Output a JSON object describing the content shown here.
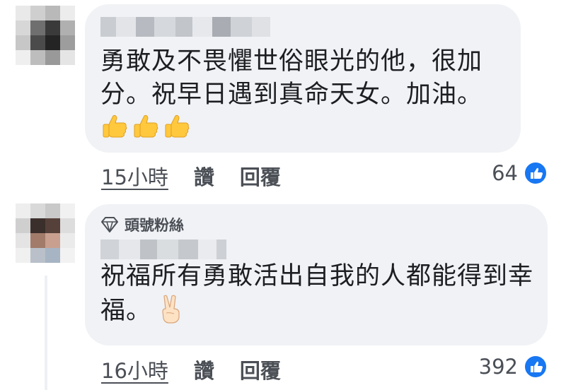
{
  "comments": [
    {
      "text": "勇敢及不畏懼世俗眼光的他，很加分。祝早日遇到真命天女。加油。",
      "emoji": [
        "thumbs-up",
        "thumbs-up",
        "thumbs-up"
      ],
      "timestamp": "15小時",
      "like_label": "讚",
      "reply_label": "回覆",
      "reaction_count": "64"
    },
    {
      "badge": "頭號粉絲",
      "text": "祝福所有勇敢活出自我的人都能得到幸福。",
      "emoji": [
        "victory-hand"
      ],
      "timestamp": "16小時",
      "like_label": "讚",
      "reply_label": "回覆",
      "reaction_count": "392"
    }
  ],
  "colors": {
    "bubble": "#f0f2f5",
    "text": "#1c1e21",
    "secondary_text": "#4b4f56",
    "like_blue": "#1877f2"
  }
}
